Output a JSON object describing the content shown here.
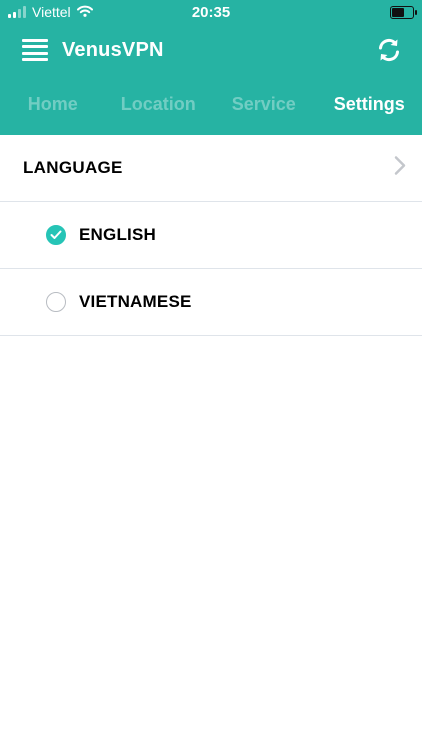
{
  "status_bar": {
    "carrier": "Viettel",
    "time": "20:35"
  },
  "app": {
    "title": "VenusVPN"
  },
  "tabs": [
    {
      "label": "Home",
      "active": false
    },
    {
      "label": "Location",
      "active": false
    },
    {
      "label": "Service",
      "active": false
    },
    {
      "label": "Settings",
      "active": true
    }
  ],
  "settings": {
    "section_title": "LANGUAGE",
    "options": [
      {
        "label": "ENGLISH",
        "selected": true
      },
      {
        "label": "VIETNAMESE",
        "selected": false
      }
    ]
  },
  "colors": {
    "header_bg": "#26b3a3",
    "accent": "#26c4b6"
  },
  "icons": [
    "menu-icon",
    "refresh-icon",
    "chevron-right-icon",
    "checkmark-icon",
    "wifi-icon",
    "battery-icon",
    "signal-icon"
  ]
}
